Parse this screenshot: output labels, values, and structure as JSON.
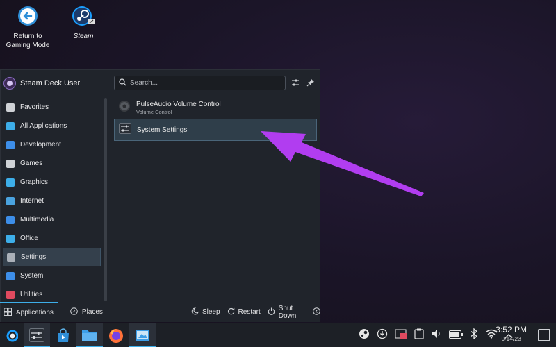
{
  "desktop": {
    "return_label": "Return to\nGaming Mode",
    "steam_label": "Steam"
  },
  "launcher": {
    "user_name": "Steam Deck User",
    "search_placeholder": "Search...",
    "categories": [
      {
        "label": "Favorites",
        "icon": "bookmark-icon",
        "color": "#cfd2d6"
      },
      {
        "label": "All Applications",
        "icon": "grid-icon",
        "color": "#3daee9"
      },
      {
        "label": "Development",
        "icon": "development-icon",
        "color": "#3d8ee9"
      },
      {
        "label": "Games",
        "icon": "gamepad-icon",
        "color": "#cfd2d6"
      },
      {
        "label": "Graphics",
        "icon": "graphics-icon",
        "color": "#3daee9"
      },
      {
        "label": "Internet",
        "icon": "globe-icon",
        "color": "#4aa3df"
      },
      {
        "label": "Multimedia",
        "icon": "multimedia-icon",
        "color": "#3d8ee9"
      },
      {
        "label": "Office",
        "icon": "office-icon",
        "color": "#3daee9"
      },
      {
        "label": "Settings",
        "icon": "settings-icon",
        "color": "#aab0b8"
      },
      {
        "label": "System",
        "icon": "system-icon",
        "color": "#3d8ee9"
      },
      {
        "label": "Utilities",
        "icon": "utilities-icon",
        "color": "#e04a5f"
      }
    ],
    "active_category": "Settings",
    "apps": [
      {
        "title": "PulseAudio Volume Control",
        "subtitle": "Volume Control"
      },
      {
        "title": "System Settings",
        "subtitle": ""
      }
    ],
    "bottom": {
      "applications": "Applications",
      "places": "Places",
      "sleep": "Sleep",
      "restart": "Restart",
      "shutdown": "Shut Down"
    }
  },
  "annotation": {
    "color": "#b13df0",
    "target": "System Settings"
  },
  "taskbar": {
    "time": "3:52 PM",
    "date": "9/14/23",
    "accent": "#3daee9"
  }
}
